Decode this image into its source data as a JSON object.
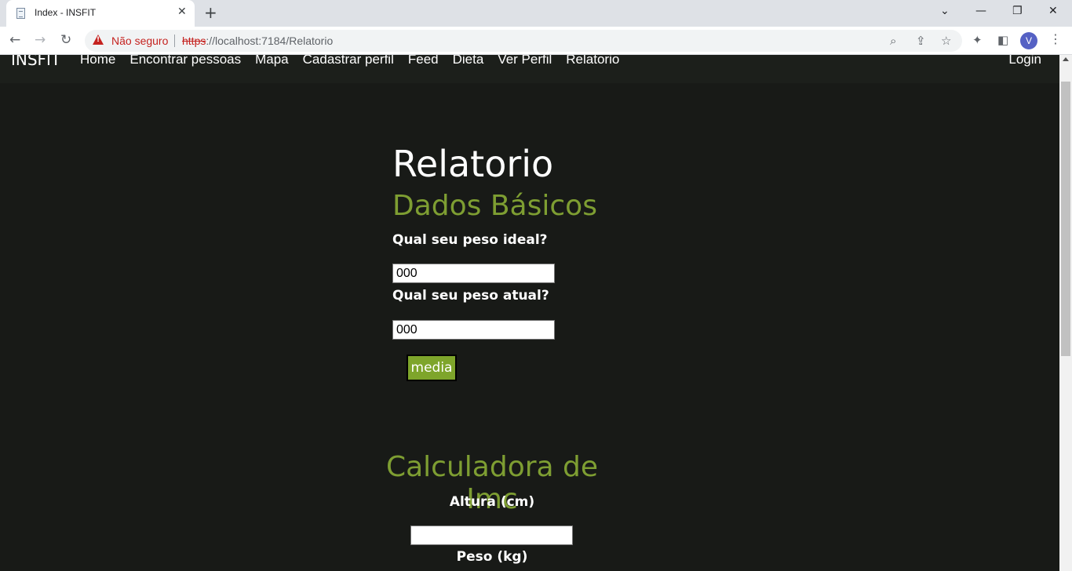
{
  "browser": {
    "tab_title": "Index - INSFIT",
    "tab_close": "✕",
    "new_tab": "+",
    "window_controls": {
      "minimize": "—",
      "restore": "❐",
      "close": "✕",
      "tabs_dropdown": "⌄"
    },
    "not_secure": "Não seguro",
    "url_scheme": "https",
    "url_rest": "://localhost:7184/Relatorio",
    "profile_initial": "V",
    "icons": [
      "back-arrow-icon",
      "forward-arrow-icon",
      "reload-icon",
      "warning-icon",
      "zoom-icon",
      "share-icon",
      "star-icon",
      "extensions-icon",
      "side-panel-icon",
      "menu-dots-icon"
    ]
  },
  "site_nav": {
    "brand": "INSFIT",
    "links": [
      "Home",
      "Encontrar pessoas",
      "Mapa",
      "Cadastrar perfil",
      "Feed",
      "Dieta",
      "Ver Perfil",
      "Relatorio"
    ],
    "login": "Login"
  },
  "page": {
    "title": "Relatorio",
    "section_basic": "Dados Básicos",
    "ideal_weight_label": "Qual seu peso ideal?",
    "ideal_weight_value": "000",
    "current_weight_label": "Qual seu peso atual?",
    "current_weight_value": "000",
    "media_button": "media",
    "section_imc": "Calculadora de Imc",
    "height_label": "Altura (cm)",
    "height_value": "",
    "weight_label": "Peso (kg)"
  },
  "colors": {
    "page_bg": "#181a17",
    "accent_green": "#7e9e32",
    "button_green": "#7ea52b",
    "insecure_red": "#c5221f"
  }
}
